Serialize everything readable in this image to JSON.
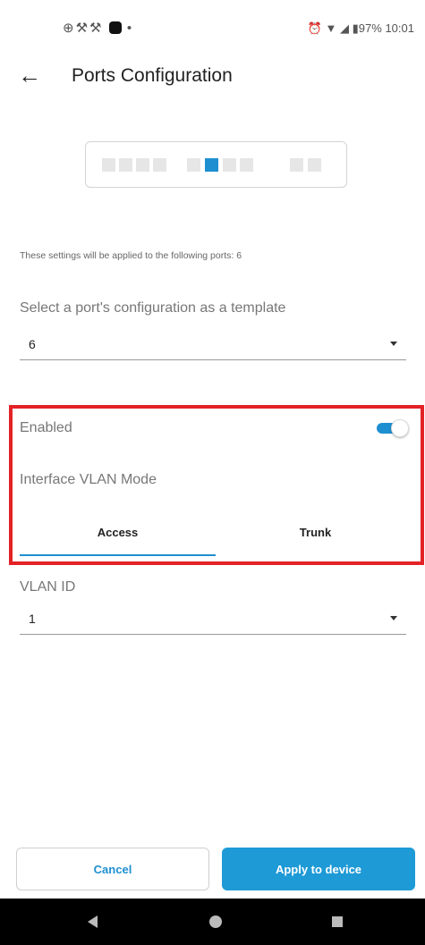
{
  "status_bar": {
    "left_icons": "⊕⚒⚒",
    "battery": "97%",
    "time": "10:01"
  },
  "header": {
    "title": "Ports Configuration"
  },
  "port_map": {
    "selected_port": 6
  },
  "info_text": "These settings will be applied to the following ports: 6",
  "template": {
    "label": "Select a port's configuration as a template",
    "value": "6"
  },
  "enabled": {
    "label": "Enabled",
    "state": true
  },
  "vlan_mode": {
    "label": "Interface VLAN Mode",
    "tabs": [
      {
        "label": "Access",
        "selected": true
      },
      {
        "label": "Trunk",
        "selected": false
      }
    ]
  },
  "vlan_id": {
    "label": "VLAN ID",
    "value": "1"
  },
  "actions": {
    "cancel_label": "Cancel",
    "apply_label": "Apply to device"
  },
  "colors": {
    "accent": "#1e8fd0",
    "highlight": "#e32226"
  }
}
